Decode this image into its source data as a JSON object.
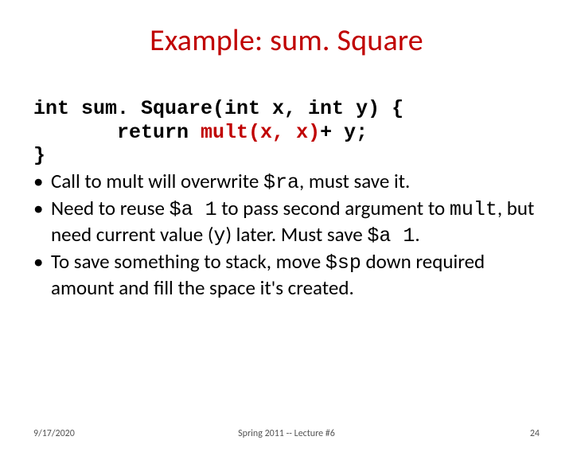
{
  "title": "Example: sum. Square",
  "code": {
    "line1_pre": "int sum. Square(int x, int y) {",
    "line2_indent": "       return ",
    "line2_call": "mult(x, x)",
    "line2_post": "+ y;",
    "line3": "}"
  },
  "bullets": [
    {
      "parts": [
        {
          "t": "Call to mult will overwrite "
        },
        {
          "t": "$ra",
          "mono": true
        },
        {
          "t": ", must save it."
        }
      ]
    },
    {
      "parts": [
        {
          "t": "Need to reuse "
        },
        {
          "t": "$a 1",
          "mono": true
        },
        {
          "t": " to pass second argument to "
        },
        {
          "t": "mult",
          "mono": true
        },
        {
          "t": ", but need current value ("
        },
        {
          "t": "y",
          "mono": true
        },
        {
          "t": ") later. Must save "
        },
        {
          "t": "$a 1",
          "mono": true
        },
        {
          "t": "."
        }
      ]
    },
    {
      "parts": [
        {
          "t": "To save something to stack, move "
        },
        {
          "t": "$sp",
          "mono": true
        },
        {
          "t": " down required amount and fill the space it's created."
        }
      ]
    }
  ],
  "footer": {
    "left": "9/17/2020",
    "center": "Spring 2011 -- Lecture #6",
    "right": "24"
  }
}
